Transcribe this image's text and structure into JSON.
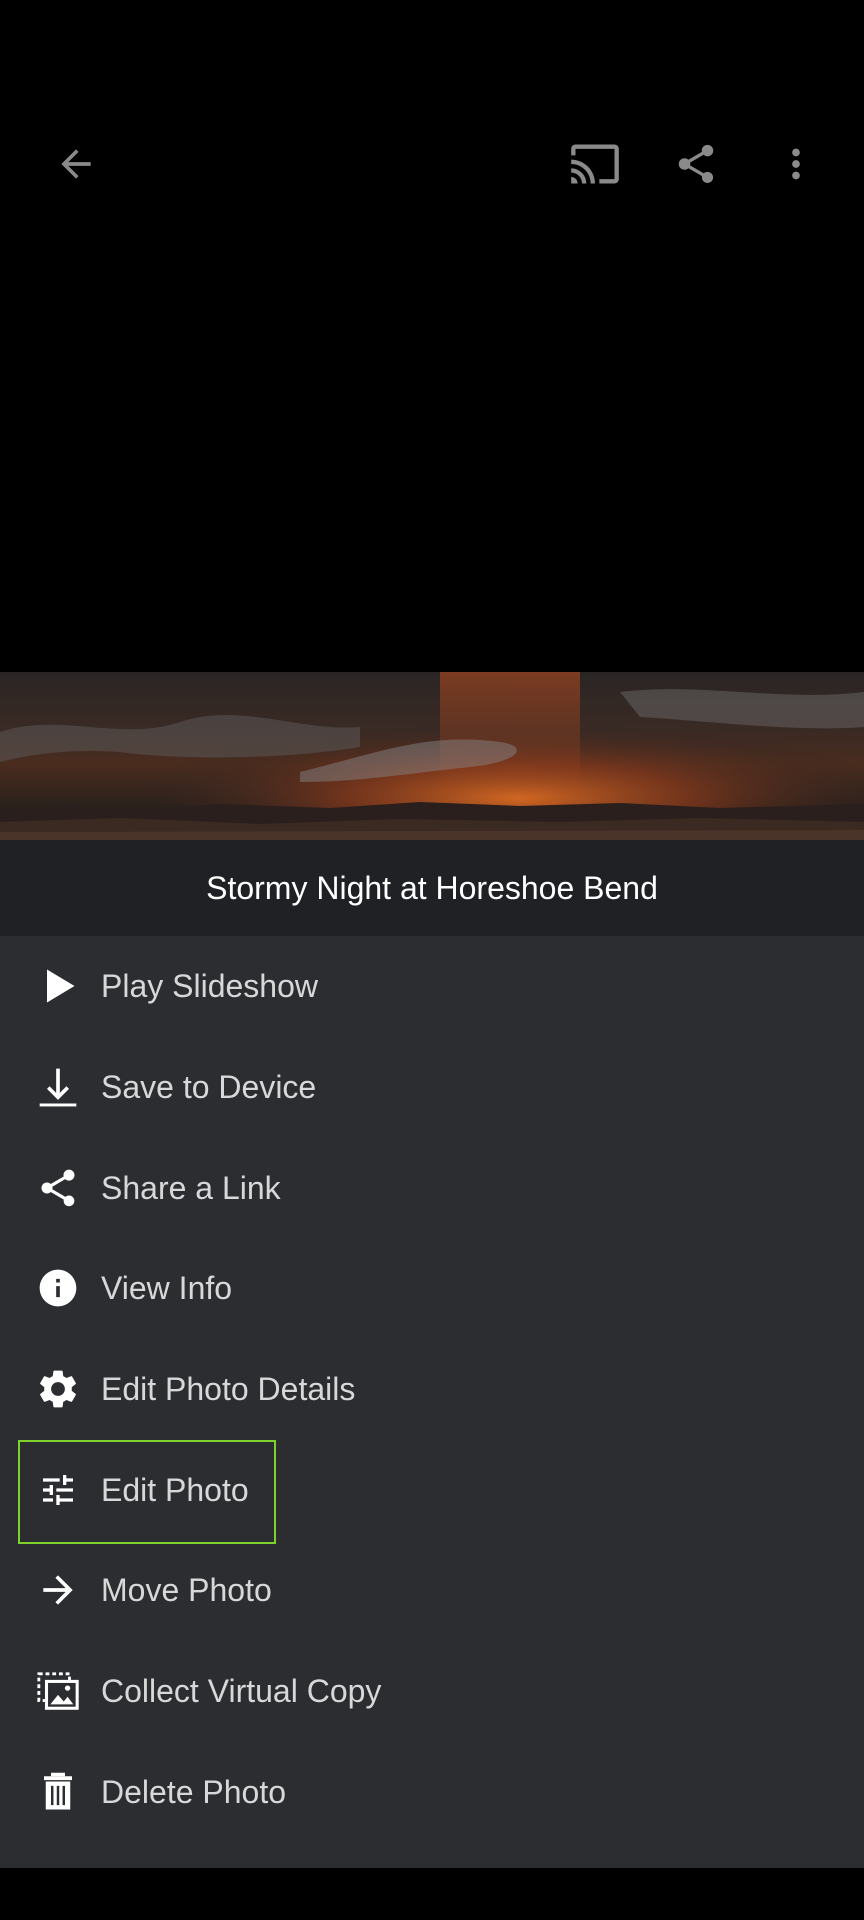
{
  "toolbar": {
    "back_icon": "arrow-back-icon",
    "cast_icon": "cast-icon",
    "share_icon": "share-icon",
    "more_icon": "more-vertical-icon"
  },
  "photo": {
    "title": "Stormy Night at Horeshoe Bend"
  },
  "menu": {
    "items": [
      {
        "label": "Play Slideshow",
        "icon": "play-icon"
      },
      {
        "label": "Save to Device",
        "icon": "download-icon"
      },
      {
        "label": "Share a Link",
        "icon": "share-icon"
      },
      {
        "label": "View Info",
        "icon": "info-icon"
      },
      {
        "label": "Edit Photo Details",
        "icon": "gear-icon"
      },
      {
        "label": "Edit Photo",
        "icon": "sliders-icon"
      },
      {
        "label": "Move Photo",
        "icon": "arrow-right-icon"
      },
      {
        "label": "Collect Virtual Copy",
        "icon": "virtual-copy-icon"
      },
      {
        "label": "Delete Photo",
        "icon": "trash-icon"
      }
    ],
    "highlighted": "Edit Photo"
  },
  "colors": {
    "background": "#000000",
    "menu_bg": "#2c2d31",
    "title_bar_bg": "#202124",
    "highlight": "#7fd12b",
    "icon": "#ffffff",
    "toolbar_icon": "#8a8a8a"
  }
}
